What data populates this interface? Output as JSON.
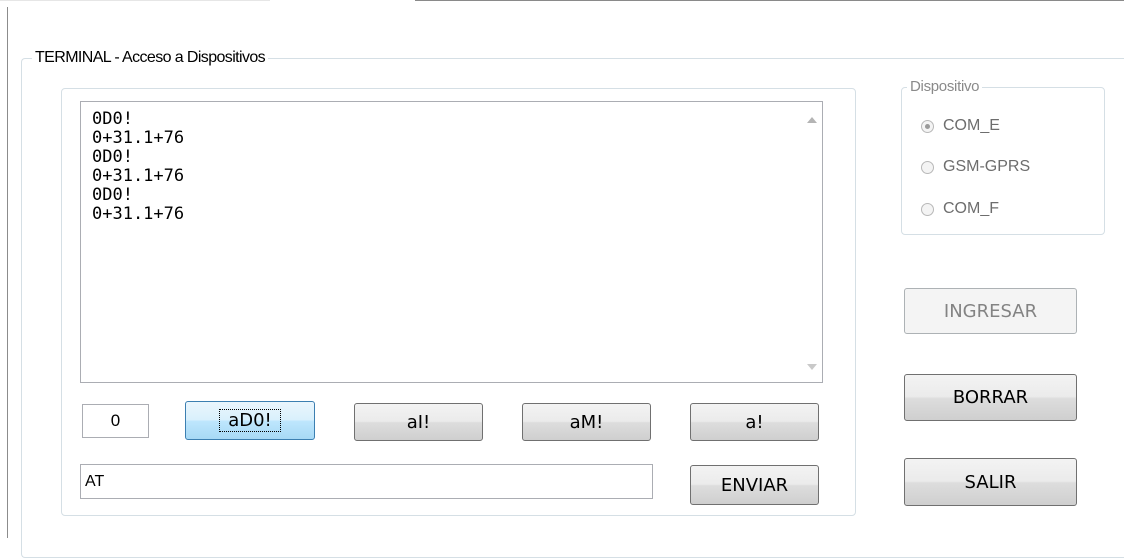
{
  "terminal": {
    "title": "TERMINAL - Acceso a Dispositivos",
    "output_lines": [
      "0D0!",
      "0+31.1+76",
      "0D0!",
      "0+31.1+76",
      "0D0!",
      "0+31.1+76"
    ],
    "counter_value": "0",
    "quick_buttons": [
      "aD0!",
      "aI!",
      "aM!",
      "a!"
    ],
    "command_value": "AT",
    "send_label": "ENVIAR"
  },
  "device": {
    "title": "Dispositivo",
    "options": [
      "COM_E",
      "GSM-GPRS",
      "COM_F"
    ],
    "selected": "COM_E"
  },
  "actions": {
    "ingresar_label": "INGRESAR",
    "borrar_label": "BORRAR",
    "salir_label": "SALIR"
  }
}
